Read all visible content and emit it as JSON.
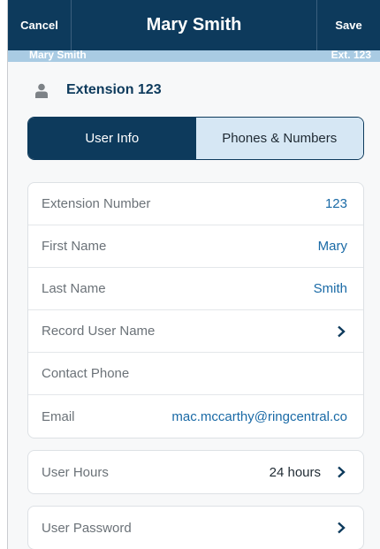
{
  "navbar": {
    "cancel_label": "Cancel",
    "title": "Mary Smith",
    "save_label": "Save"
  },
  "subheader": {
    "name": "Mary Smith",
    "ext": "Ext. 123"
  },
  "heading": {
    "icon": "user-icon",
    "text": "Extension 123"
  },
  "tabs": [
    {
      "label": "User Info",
      "active": true
    },
    {
      "label": "Phones & Numbers",
      "active": false
    }
  ],
  "fields": [
    {
      "label": "Extension Number",
      "value": "123"
    },
    {
      "label": "First Name",
      "value": "Mary"
    },
    {
      "label": "Last Name",
      "value": "Smith"
    },
    {
      "label": "Record User Name",
      "value": "",
      "chevron": true
    },
    {
      "label": "Contact Phone",
      "value": ""
    },
    {
      "label": "Email",
      "value": "mac.mccarthy@ringcentral.co"
    }
  ],
  "user_hours": {
    "label": "User Hours",
    "value": "24 hours"
  },
  "user_password": {
    "label": "User Password"
  },
  "colors": {
    "navbar": "#0d3a5c",
    "subheader": "#a9cbe3",
    "accent_value": "#1a6aa6",
    "tab_inactive": "#d6e7f4"
  }
}
